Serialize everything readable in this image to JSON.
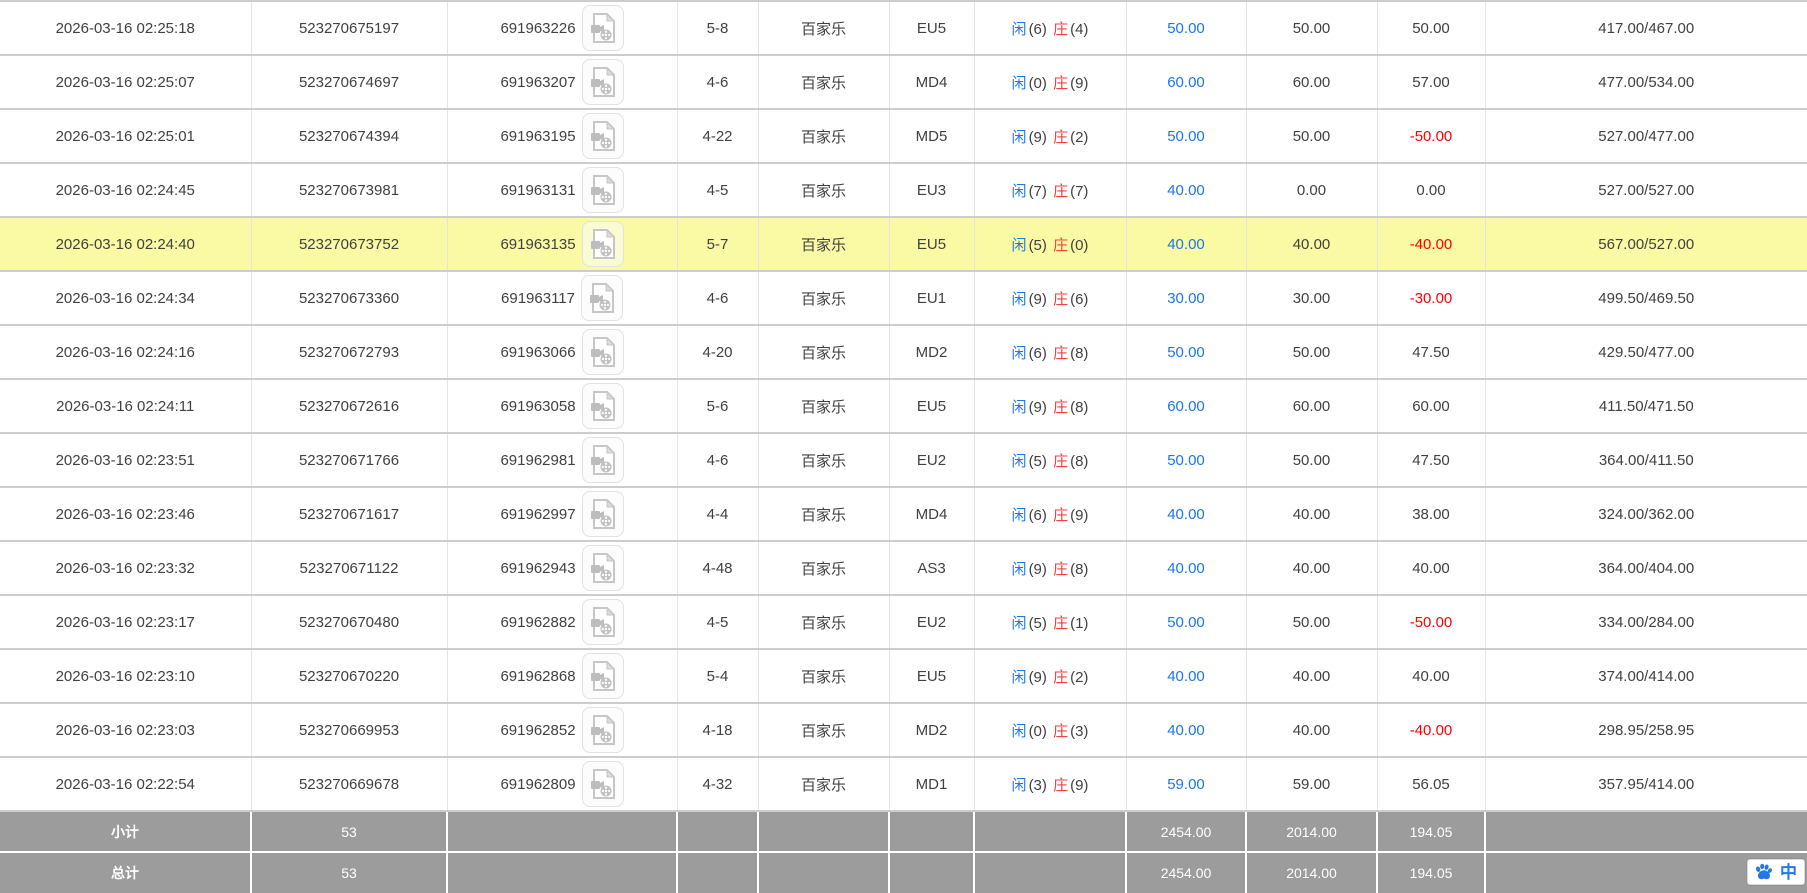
{
  "colors": {
    "accent_blue": "#1a78e8",
    "banker_red": "#f0413e",
    "negative_red": "#fe0000",
    "highlight_yellow": "#fafaa5",
    "footer_gray": "#9c9c9c"
  },
  "table": {
    "rows": [
      {
        "time": "2026-03-16 02:25:18",
        "order_no": "523270675197",
        "game_no": "691963226",
        "seat": "5-8",
        "game_type": "百家乐",
        "table_code": "EU5",
        "player_label": "闲",
        "player_score": "(6)",
        "banker_label": "庄",
        "banker_score": "(4)",
        "bet": "50.00",
        "valid": "50.00",
        "winloss": "50.00",
        "balance": "417.00/467.00",
        "highlighted": false
      },
      {
        "time": "2026-03-16 02:25:07",
        "order_no": "523270674697",
        "game_no": "691963207",
        "seat": "4-6",
        "game_type": "百家乐",
        "table_code": "MD4",
        "player_label": "闲",
        "player_score": "(0)",
        "banker_label": "庄",
        "banker_score": "(9)",
        "bet": "60.00",
        "valid": "60.00",
        "winloss": "57.00",
        "balance": "477.00/534.00",
        "highlighted": false
      },
      {
        "time": "2026-03-16 02:25:01",
        "order_no": "523270674394",
        "game_no": "691963195",
        "seat": "4-22",
        "game_type": "百家乐",
        "table_code": "MD5",
        "player_label": "闲",
        "player_score": "(9)",
        "banker_label": "庄",
        "banker_score": "(2)",
        "bet": "50.00",
        "valid": "50.00",
        "winloss": "-50.00",
        "balance": "527.00/477.00",
        "highlighted": false
      },
      {
        "time": "2026-03-16 02:24:45",
        "order_no": "523270673981",
        "game_no": "691963131",
        "seat": "4-5",
        "game_type": "百家乐",
        "table_code": "EU3",
        "player_label": "闲",
        "player_score": "(7)",
        "banker_label": "庄",
        "banker_score": "(7)",
        "bet": "40.00",
        "valid": "0.00",
        "winloss": "0.00",
        "balance": "527.00/527.00",
        "highlighted": false
      },
      {
        "time": "2026-03-16 02:24:40",
        "order_no": "523270673752",
        "game_no": "691963135",
        "seat": "5-7",
        "game_type": "百家乐",
        "table_code": "EU5",
        "player_label": "闲",
        "player_score": "(5)",
        "banker_label": "庄",
        "banker_score": "(0)",
        "bet": "40.00",
        "valid": "40.00",
        "winloss": "-40.00",
        "balance": "567.00/527.00",
        "highlighted": true
      },
      {
        "time": "2026-03-16 02:24:34",
        "order_no": "523270673360",
        "game_no": "691963117",
        "seat": "4-6",
        "game_type": "百家乐",
        "table_code": "EU1",
        "player_label": "闲",
        "player_score": "(9)",
        "banker_label": "庄",
        "banker_score": "(6)",
        "bet": "30.00",
        "valid": "30.00",
        "winloss": "-30.00",
        "balance": "499.50/469.50",
        "highlighted": false
      },
      {
        "time": "2026-03-16 02:24:16",
        "order_no": "523270672793",
        "game_no": "691963066",
        "seat": "4-20",
        "game_type": "百家乐",
        "table_code": "MD2",
        "player_label": "闲",
        "player_score": "(6)",
        "banker_label": "庄",
        "banker_score": "(8)",
        "bet": "50.00",
        "valid": "50.00",
        "winloss": "47.50",
        "balance": "429.50/477.00",
        "highlighted": false
      },
      {
        "time": "2026-03-16 02:24:11",
        "order_no": "523270672616",
        "game_no": "691963058",
        "seat": "5-6",
        "game_type": "百家乐",
        "table_code": "EU5",
        "player_label": "闲",
        "player_score": "(9)",
        "banker_label": "庄",
        "banker_score": "(8)",
        "bet": "60.00",
        "valid": "60.00",
        "winloss": "60.00",
        "balance": "411.50/471.50",
        "highlighted": false
      },
      {
        "time": "2026-03-16 02:23:51",
        "order_no": "523270671766",
        "game_no": "691962981",
        "seat": "4-6",
        "game_type": "百家乐",
        "table_code": "EU2",
        "player_label": "闲",
        "player_score": "(5)",
        "banker_label": "庄",
        "banker_score": "(8)",
        "bet": "50.00",
        "valid": "50.00",
        "winloss": "47.50",
        "balance": "364.00/411.50",
        "highlighted": false
      },
      {
        "time": "2026-03-16 02:23:46",
        "order_no": "523270671617",
        "game_no": "691962997",
        "seat": "4-4",
        "game_type": "百家乐",
        "table_code": "MD4",
        "player_label": "闲",
        "player_score": "(6)",
        "banker_label": "庄",
        "banker_score": "(9)",
        "bet": "40.00",
        "valid": "40.00",
        "winloss": "38.00",
        "balance": "324.00/362.00",
        "highlighted": false
      },
      {
        "time": "2026-03-16 02:23:32",
        "order_no": "523270671122",
        "game_no": "691962943",
        "seat": "4-48",
        "game_type": "百家乐",
        "table_code": "AS3",
        "player_label": "闲",
        "player_score": "(9)",
        "banker_label": "庄",
        "banker_score": "(8)",
        "bet": "40.00",
        "valid": "40.00",
        "winloss": "40.00",
        "balance": "364.00/404.00",
        "highlighted": false
      },
      {
        "time": "2026-03-16 02:23:17",
        "order_no": "523270670480",
        "game_no": "691962882",
        "seat": "4-5",
        "game_type": "百家乐",
        "table_code": "EU2",
        "player_label": "闲",
        "player_score": "(5)",
        "banker_label": "庄",
        "banker_score": "(1)",
        "bet": "50.00",
        "valid": "50.00",
        "winloss": "-50.00",
        "balance": "334.00/284.00",
        "highlighted": false
      },
      {
        "time": "2026-03-16 02:23:10",
        "order_no": "523270670220",
        "game_no": "691962868",
        "seat": "5-4",
        "game_type": "百家乐",
        "table_code": "EU5",
        "player_label": "闲",
        "player_score": "(9)",
        "banker_label": "庄",
        "banker_score": "(2)",
        "bet": "40.00",
        "valid": "40.00",
        "winloss": "40.00",
        "balance": "374.00/414.00",
        "highlighted": false
      },
      {
        "time": "2026-03-16 02:23:03",
        "order_no": "523270669953",
        "game_no": "691962852",
        "seat": "4-18",
        "game_type": "百家乐",
        "table_code": "MD2",
        "player_label": "闲",
        "player_score": "(0)",
        "banker_label": "庄",
        "banker_score": "(3)",
        "bet": "40.00",
        "valid": "40.00",
        "winloss": "-40.00",
        "balance": "298.95/258.95",
        "highlighted": false
      },
      {
        "time": "2026-03-16 02:22:54",
        "order_no": "523270669678",
        "game_no": "691962809",
        "seat": "4-32",
        "game_type": "百家乐",
        "table_code": "MD1",
        "player_label": "闲",
        "player_score": "(3)",
        "banker_label": "庄",
        "banker_score": "(9)",
        "bet": "59.00",
        "valid": "59.00",
        "winloss": "56.05",
        "balance": "357.95/414.00",
        "highlighted": false
      }
    ],
    "footer": {
      "subtotal": {
        "label": "小计",
        "count": "53",
        "bet": "2454.00",
        "valid": "2014.00",
        "winloss": "194.05"
      },
      "total": {
        "label": "总计",
        "count": "53",
        "bet": "2454.00",
        "valid": "2014.00",
        "winloss": "194.05"
      }
    }
  },
  "overlay": {
    "translate_char": "中"
  }
}
